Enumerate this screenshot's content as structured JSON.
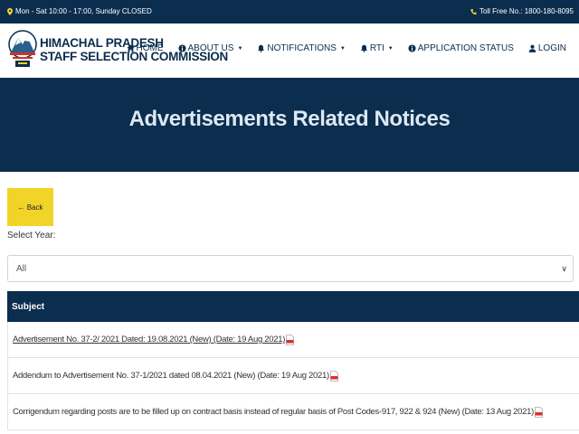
{
  "topbar": {
    "hours": "Mon - Sat 10:00 - 17:00, Sunday CLOSED",
    "tollfree": "Toll Free No.: 1800-180-8095"
  },
  "brand": {
    "line1": "HIMACHAL PRADESH",
    "line2": "STAFF SELECTION COMMISSION"
  },
  "nav": {
    "home": "HOME",
    "about": "ABOUT US",
    "notifications": "NOTIFICATIONS",
    "rti": "RTI",
    "status": "APPLICATION STATUS",
    "login": "LOGIN"
  },
  "hero": {
    "title": "Advertisements Related Notices"
  },
  "back": {
    "label": "Back"
  },
  "year": {
    "label": "Select Year:",
    "selected": "All"
  },
  "table": {
    "header": "Subject",
    "rows": [
      "Advertisement No. 37-2/ 2021 Dated: 19.08.2021 (New) (Date: 19 Aug 2021)",
      "Addendum to Advertisement No. 37-1/2021 dated 08.04.2021 (New) (Date: 19 Aug 2021)",
      "Corrigendum regarding posts are to be filled up on contract basis instead of regular basis of Post Codes-917, 922 & 924 (New) (Date: 13 Aug 2021)"
    ]
  },
  "colors": {
    "navy": "#0b2d4e",
    "accent": "#f2d327",
    "pdf": "#d9302b"
  }
}
